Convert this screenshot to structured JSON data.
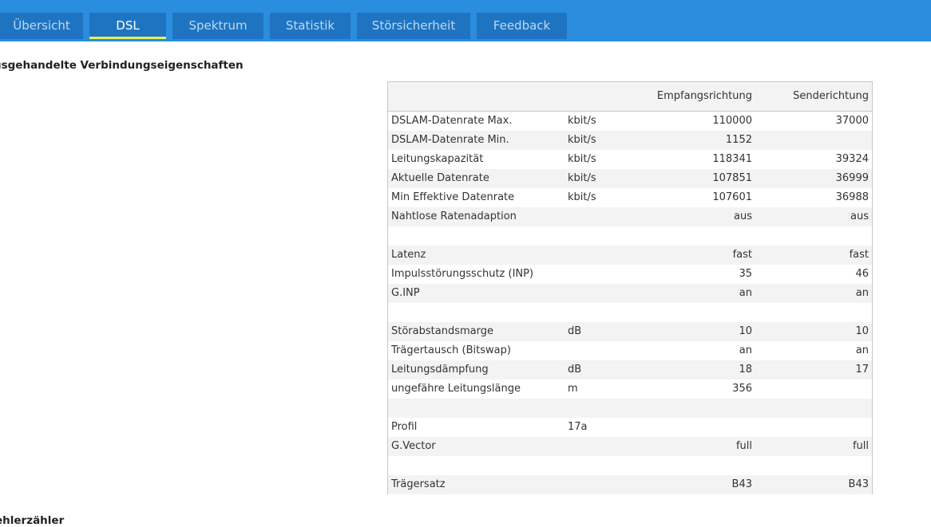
{
  "tabs": [
    {
      "label": "Übersicht",
      "active": false
    },
    {
      "label": "DSL",
      "active": true
    },
    {
      "label": "Spektrum",
      "active": false
    },
    {
      "label": "Statistik",
      "active": false
    },
    {
      "label": "Störsicherheit",
      "active": false
    },
    {
      "label": "Feedback",
      "active": false
    }
  ],
  "section_title": "usgehandelte Verbindungseigenschaften",
  "section_title_2": "ehlerzähler",
  "table": {
    "headers": {
      "down": "Empfangsrichtung",
      "up": "Senderichtung"
    },
    "rows": [
      {
        "label": "DSLAM-Datenrate Max.",
        "unit": "kbit/s",
        "down": "110000",
        "up": "37000"
      },
      {
        "label": "DSLAM-Datenrate Min.",
        "unit": "kbit/s",
        "down": "1152",
        "up": ""
      },
      {
        "label": "Leitungskapazität",
        "unit": "kbit/s",
        "down": "118341",
        "up": "39324"
      },
      {
        "label": "Aktuelle Datenrate",
        "unit": "kbit/s",
        "down": "107851",
        "up": "36999"
      },
      {
        "label": "Min Effektive Datenrate",
        "unit": "kbit/s",
        "down": "107601",
        "up": "36988"
      },
      {
        "label": "Nahtlose Ratenadaption",
        "unit": "",
        "down": "aus",
        "up": "aus"
      },
      {
        "label": "",
        "unit": "",
        "down": "",
        "up": ""
      },
      {
        "label": "Latenz",
        "unit": "",
        "down": "fast",
        "up": "fast"
      },
      {
        "label": "Impulsstörungsschutz (INP)",
        "unit": "",
        "down": "35",
        "up": "46"
      },
      {
        "label": "G.INP",
        "unit": "",
        "down": "an",
        "up": "an"
      },
      {
        "label": "",
        "unit": "",
        "down": "",
        "up": ""
      },
      {
        "label": "Störabstandsmarge",
        "unit": "dB",
        "down": "10",
        "up": "10"
      },
      {
        "label": "Trägertausch (Bitswap)",
        "unit": "",
        "down": "an",
        "up": "an"
      },
      {
        "label": "Leitungsdämpfung",
        "unit": "dB",
        "down": "18",
        "up": "17"
      },
      {
        "label": "ungefähre Leitungslänge",
        "unit": "m",
        "down": "356",
        "up": ""
      },
      {
        "label": "",
        "unit": "",
        "down": "",
        "up": ""
      },
      {
        "label": "Profil",
        "unit": "17a",
        "down": "",
        "up": ""
      },
      {
        "label": "G.Vector",
        "unit": "",
        "down": "full",
        "up": "full"
      },
      {
        "label": "",
        "unit": "",
        "down": "",
        "up": ""
      },
      {
        "label": "Trägersatz",
        "unit": "",
        "down": "B43",
        "up": "B43"
      }
    ]
  },
  "colors": {
    "tabbar": "#2a8ddd",
    "tab": "#1f74c2",
    "active_underline": "#e6ee55",
    "row_shade": "#f3f3f3"
  }
}
